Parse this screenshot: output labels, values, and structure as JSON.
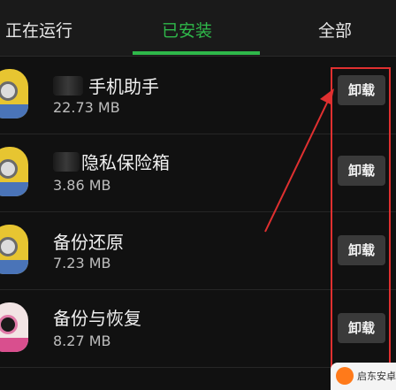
{
  "tabs": [
    {
      "label": "正在运行"
    },
    {
      "label": "已安装"
    },
    {
      "label": "全部"
    }
  ],
  "apps": [
    {
      "name": "手机助手",
      "size": "22.73 MB",
      "uninstall": "卸载"
    },
    {
      "name": "隐私保险箱",
      "size": "3.86 MB",
      "uninstall": "卸载"
    },
    {
      "name": "备份还原",
      "size": "7.23 MB",
      "uninstall": "卸载"
    },
    {
      "name": "备份与恢复",
      "size": "8.27 MB",
      "uninstall": "卸载"
    }
  ],
  "colors": {
    "accent": "#2fb84a",
    "highlight": "#e03030"
  },
  "watermark": {
    "text": "启东安卓网"
  }
}
